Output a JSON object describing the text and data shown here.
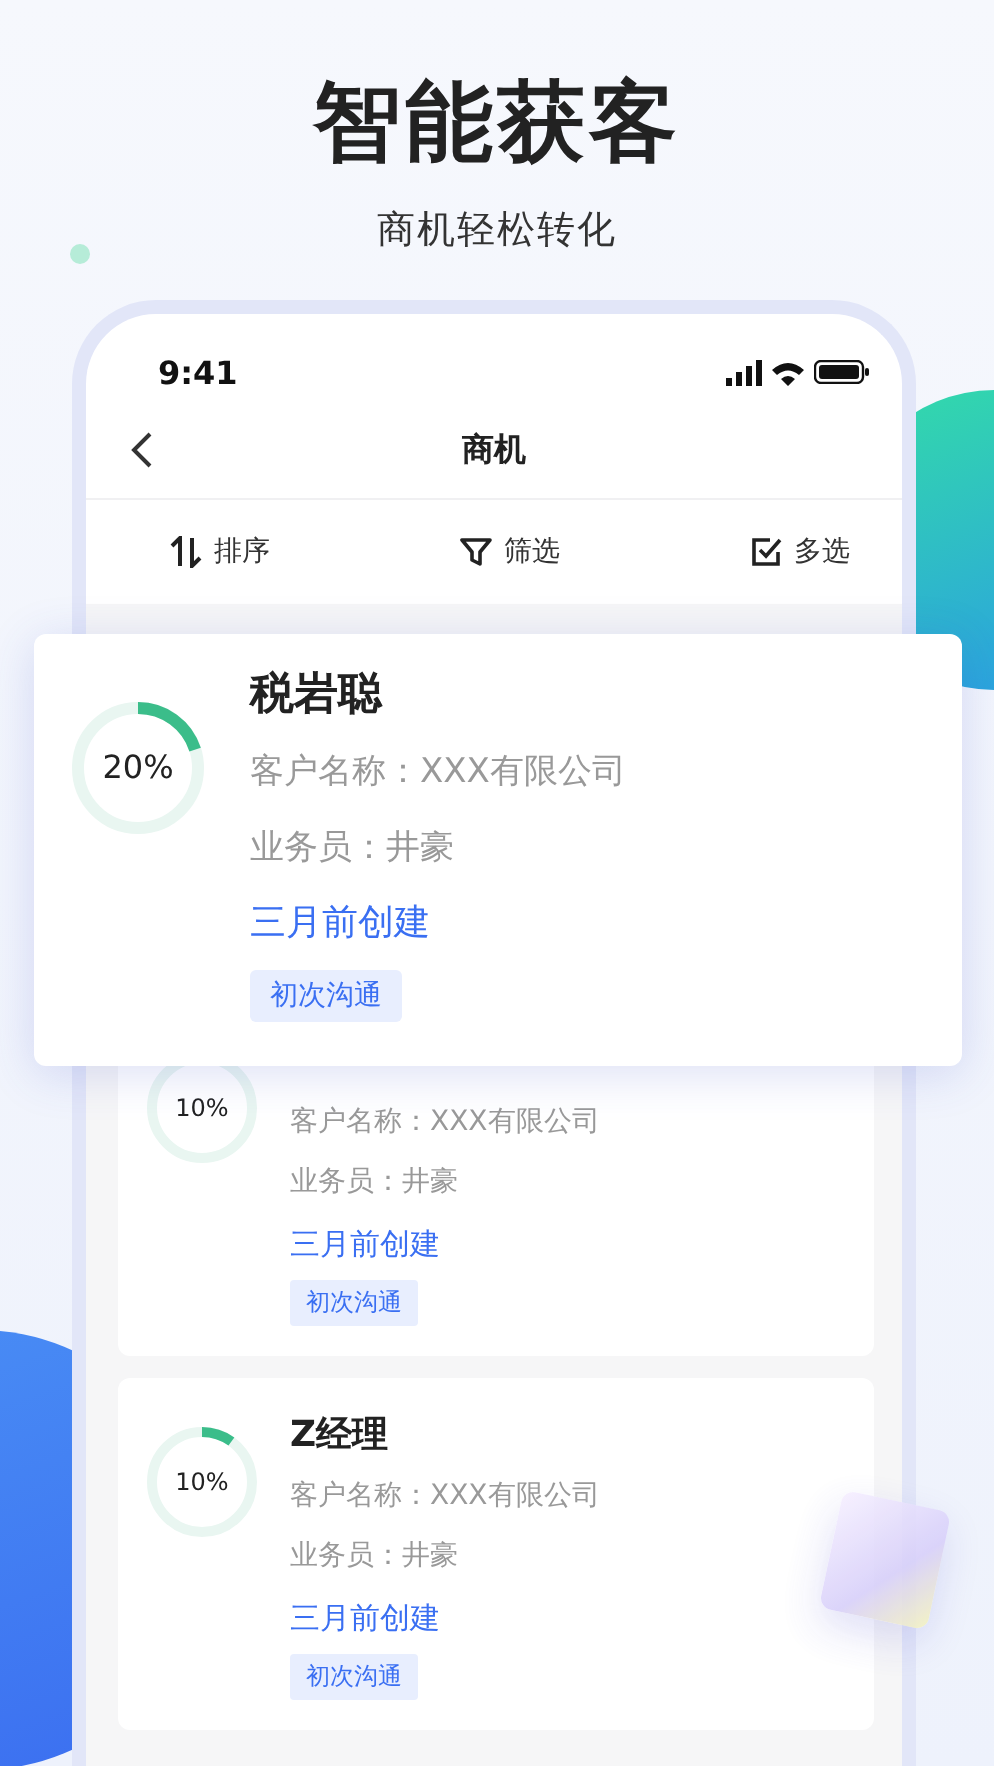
{
  "headline": "智能获客",
  "subtitle": "商机轻松转化",
  "status_bar": {
    "time": "9:41"
  },
  "nav": {
    "title": "商机"
  },
  "toolbar": [
    {
      "kind": "sort",
      "label": "排序"
    },
    {
      "kind": "filter",
      "label": "筛选"
    },
    {
      "kind": "multi",
      "label": "多选"
    }
  ],
  "featured_card": {
    "percent": "20%",
    "level": 0.2,
    "name": "税岩聪",
    "customer": "客户名称：XXX有限公司",
    "salesperson": "业务员：井豪",
    "created": "三月前创建",
    "tag": "初次沟通"
  },
  "cards": [
    {
      "percent": "10%",
      "customer": "客户名称：XXX有限公司",
      "salesperson": "业务员：井豪",
      "created": "三月前创建",
      "tag": "初次沟通"
    },
    {
      "percent": "10%",
      "level": 0.1,
      "name": "Z经理",
      "customer": "客户名称：XXX有限公司",
      "salesperson": "业务员：井豪",
      "created": "三月前创建",
      "tag": "初次沟通"
    }
  ]
}
